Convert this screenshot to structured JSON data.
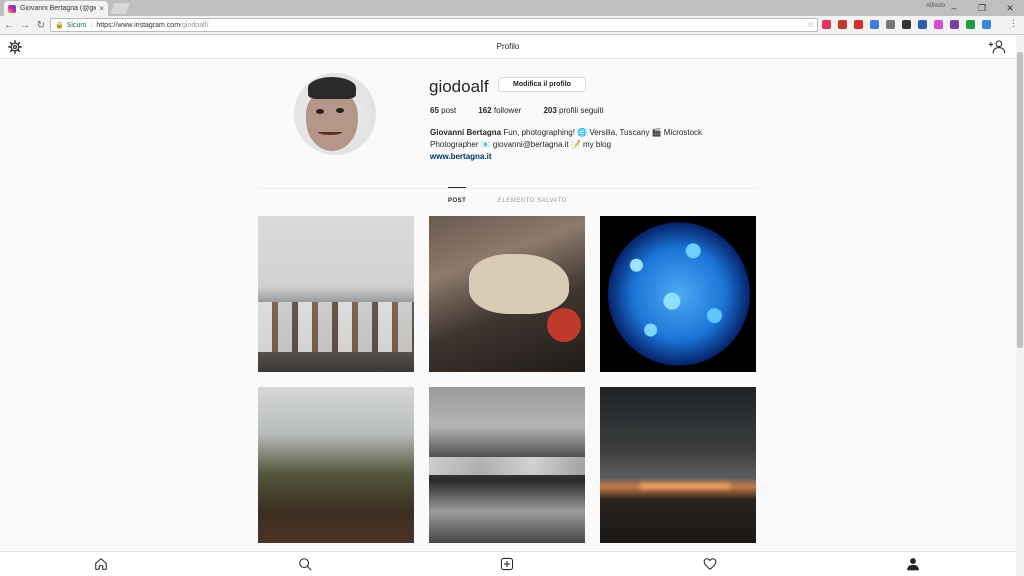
{
  "browser": {
    "tab_title": "Giovanni Bertagna (@gio",
    "tab_close": "×",
    "user_name": "Alfredo",
    "win_controls": [
      "–",
      "❐",
      "✕"
    ],
    "secure_label": "Sicuro",
    "url_host": "https://www.instagram.com",
    "url_path": "/giodoalf/",
    "star": "☆",
    "menu": "⋮",
    "back": "←",
    "forward": "→",
    "reload": "↻",
    "extension_colors": [
      "#e2345a",
      "#c0392b",
      "#d62d2d",
      "#3b7de0",
      "#777777",
      "#333333",
      "#2c5fa8",
      "#d94bd1",
      "#7b3fa0",
      "#1e9e44",
      "#3a86d8"
    ]
  },
  "header": {
    "title": "Profilo"
  },
  "profile": {
    "username": "giodoalf",
    "edit_button": "Modifica il profilo",
    "stats": {
      "posts_count": "65",
      "posts_label": "post",
      "followers_count": "162",
      "followers_label": "follower",
      "following_count": "203",
      "following_label": "profili seguiti"
    },
    "full_name": "Giovanni Bertagna",
    "bio_line1": " Fun, photographing! 🌐 Versilia, Tuscany 🎬 Microstock",
    "bio_line2": "Photographer 📧 giovanni@bertagna.it 📝 my blog",
    "website": "www.bertagna.it"
  },
  "tabs": {
    "post": "POST",
    "saved": "ELEMENTO SALVATO"
  },
  "photos": [
    {
      "subject": "snowy rooftops"
    },
    {
      "subject": "carnival float horse"
    },
    {
      "subject": "blue bokeh lights"
    },
    {
      "subject": "misty hedge"
    },
    {
      "subject": "black and white sea waves"
    },
    {
      "subject": "sunset under dark clouds"
    }
  ]
}
